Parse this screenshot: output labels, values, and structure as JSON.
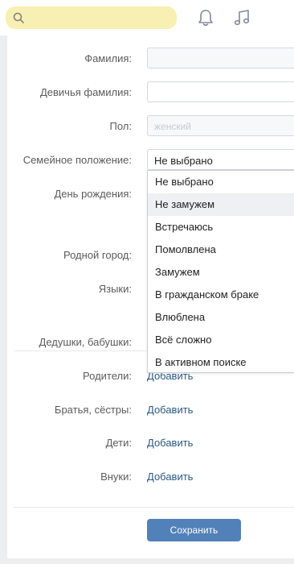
{
  "header": {
    "search_placeholder": "",
    "icons": [
      "search-icon",
      "bell-icon",
      "music-note-icon"
    ]
  },
  "form": {
    "surname_label": "Фамилия:",
    "maiden_name_label": "Девичья фамилия:",
    "gender_label": "Пол:",
    "gender_value": "женский",
    "marital_status_label": "Семейное положение:",
    "marital_status_value": "Не выбрано",
    "birthday_label": "День рождения:",
    "hometown_label": "Родной город:",
    "languages_label": "Языки:",
    "grandparents_label": "Дедушки, бабушки:",
    "parents_label": "Родители:",
    "siblings_label": "Братья, сёстры:",
    "children_label": "Дети:",
    "grandchildren_label": "Внуки:",
    "add_link": "Добавить",
    "save_button": "Сохранить"
  },
  "marital_options": [
    "Не выбрано",
    "Не замужем",
    "Встречаюсь",
    "Помолвлена",
    "Замужем",
    "В гражданском браке",
    "Влюблена",
    "Всё сложно",
    "В активном поиске"
  ],
  "hovered_option": "Не замужем",
  "colors": {
    "search_bg": "#f7f0b2",
    "link": "#2a5885",
    "button": "#5181b8",
    "page_bg": "#edeef0"
  }
}
